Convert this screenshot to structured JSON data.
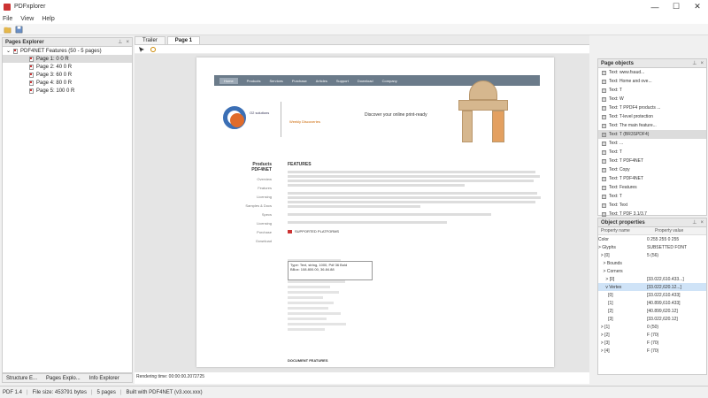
{
  "window": {
    "title": "PDFxplorer",
    "minimize": "—",
    "maximize": "☐",
    "close": "✕"
  },
  "menu": [
    "File",
    "View",
    "Help"
  ],
  "explorer": {
    "title": "Pages Explorer",
    "root": "PDF4NET Features (50 - 5 pages)",
    "pages": [
      "Page 1: 0 0 R",
      "Page 2: 40 0 R",
      "Page 3: 60 0 R",
      "Page 4: 80 0 R",
      "Page 5: 100 0 R"
    ],
    "tabs": [
      "Structure E...",
      "Pages Explo...",
      "Info Explorer"
    ]
  },
  "center": {
    "tabs": [
      "Trailer",
      "Page 1"
    ],
    "page": {
      "nav": [
        "Home",
        "Products",
        "Services",
        "Purchase",
        "Articles",
        "Support",
        "Download",
        "Company"
      ],
      "logo_text": "O2\nsolutions",
      "tagline": "Weekly Discoveries",
      "slogan": "Discover your online print-ready",
      "side_title": "Products PDF4NET",
      "side_items": [
        "Overview",
        "Features",
        "Licensing",
        "Samples & Docs",
        "Specs",
        "Licensing",
        "Purchase",
        "Download"
      ],
      "features_title": "FEATURES",
      "supported_header": "SUPPORTED PLATFORMS",
      "tooltip": "Type: Text, string, 1000, Pdf 36 Bold\nBBox: 108.800.00, 36.84.88",
      "doc_features": "DOCUMENT FEATURES"
    },
    "rendering": "Rendering time: 00:00:00.2072725"
  },
  "page_objects": {
    "title": "Page objects",
    "rows": [
      "Text: www.fsaud...",
      "Text: Home and ove...",
      "Text: T",
      "Text: W",
      "Text: T PPDF4 products ...",
      "Text: T-level protection",
      "Text: The main feature...",
      "Text: T (BR3SPDF4)",
      "Text: ...",
      "Text: T",
      "Text: T PDF4NET",
      "Text: Copy",
      "Text: T PDF4NET",
      "Text: Features",
      "Text: T",
      "Text: Text",
      "Text: T PDF 3.1/3.7",
      "Text: T PDF 3.1"
    ]
  },
  "object_properties": {
    "title": "Object properties",
    "col_name": "Property name",
    "col_value": "Property value",
    "rows": [
      {
        "k": "Color",
        "v": "0 255 255 0 255"
      },
      {
        "k": "> Glyphs",
        "v": "SUBSETTED FONT"
      },
      {
        "k": "  > [0]",
        "v": "5 (56)"
      },
      {
        "k": "    > Bounds",
        "v": ""
      },
      {
        "k": "    > Corners",
        "v": ""
      },
      {
        "k": "      > [0]",
        "v": "[33.022,610.433...]"
      },
      {
        "k": "      v Vertex",
        "v": "[33.022,620.12...]"
      },
      {
        "k": "        [0]",
        "v": "[33.022,610.433]"
      },
      {
        "k": "        [1]",
        "v": "[40.899,610.433]"
      },
      {
        "k": "        [2]",
        "v": "[40.899,620.12]"
      },
      {
        "k": "        [3]",
        "v": "[33.022,620.12]"
      },
      {
        "k": "  > [1]",
        "v": "0 (50)"
      },
      {
        "k": "  > [2]",
        "v": "F (70)"
      },
      {
        "k": "  > [3]",
        "v": "F (70)"
      },
      {
        "k": "  > [4]",
        "v": "F (70)"
      }
    ]
  },
  "status": {
    "version": "PDF 1.4",
    "filesize": "File size: 453791 bytes",
    "pages": "5 pages",
    "builder": "Built with PDF4NET (v3.xxx.xxx)"
  }
}
